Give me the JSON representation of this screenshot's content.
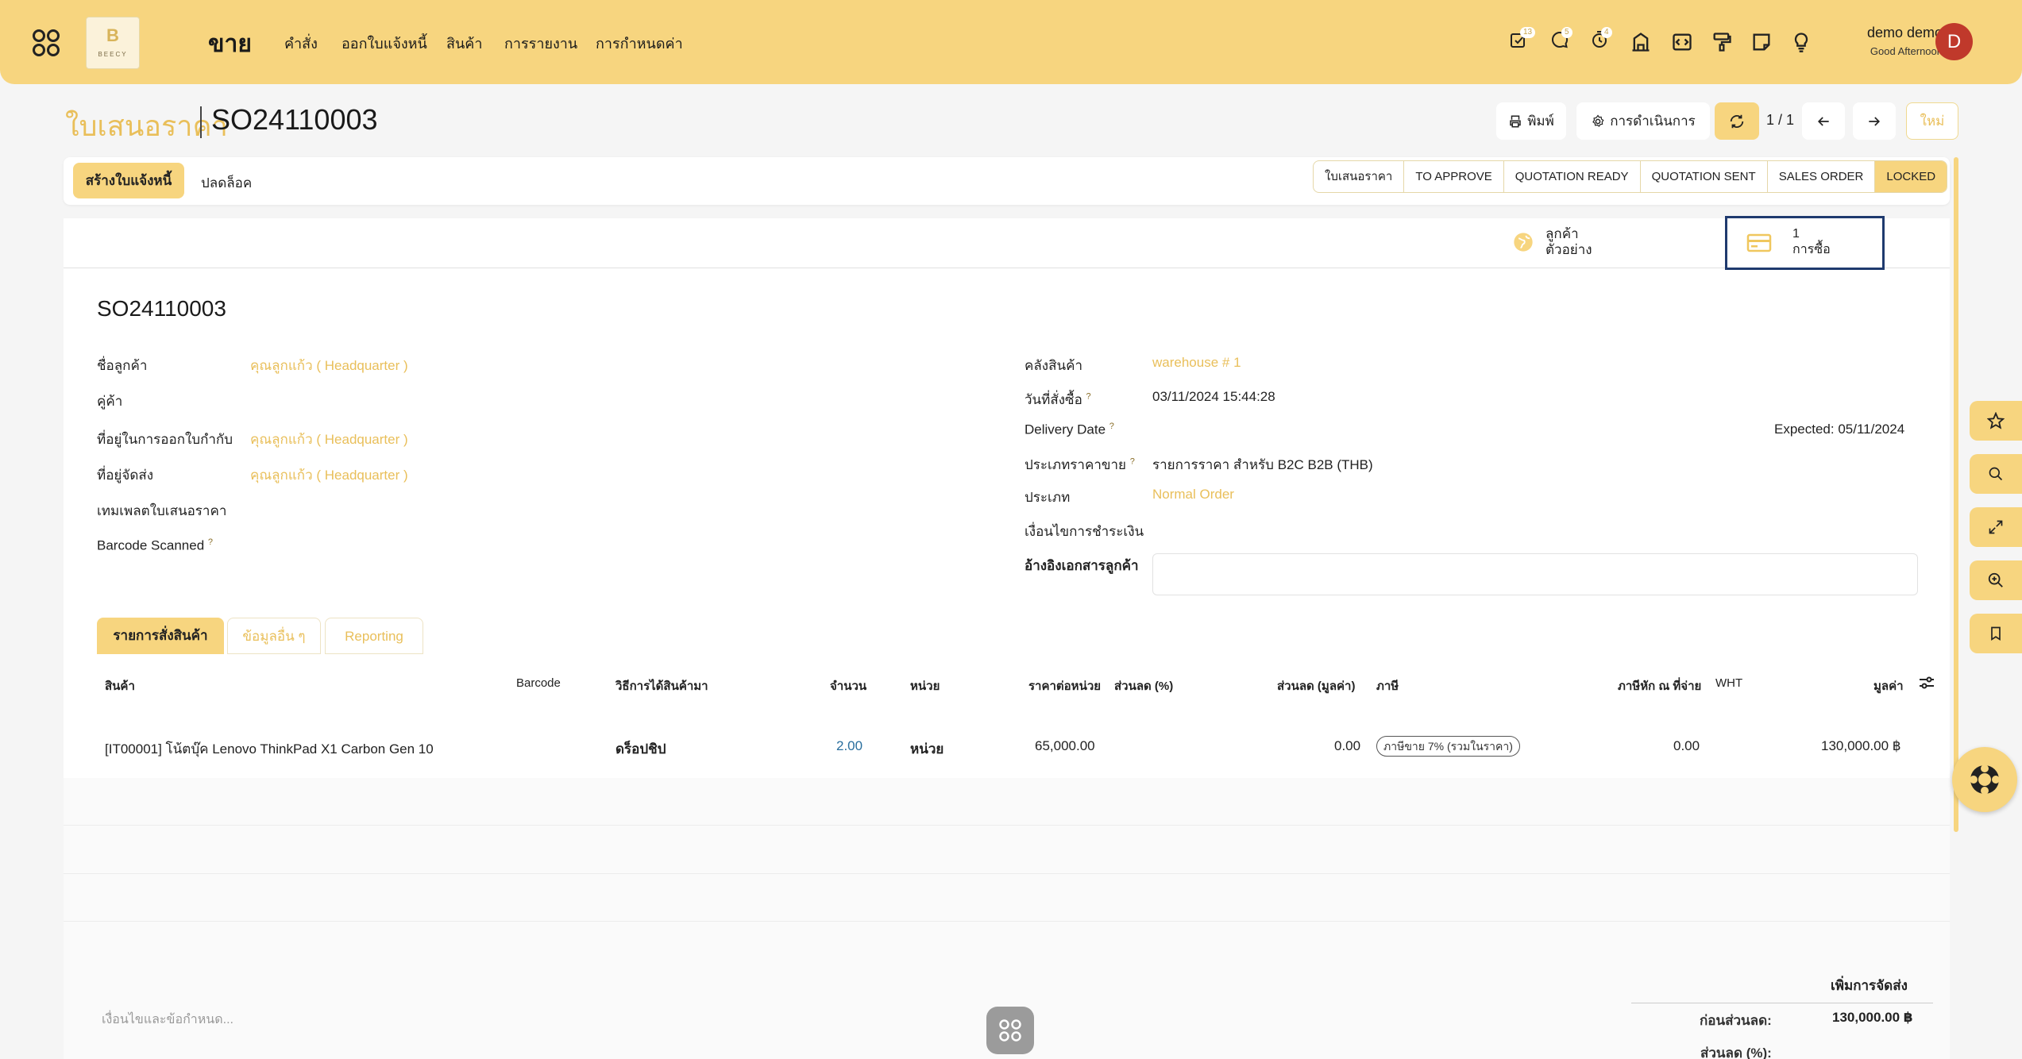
{
  "header": {
    "logo_letter": "B",
    "logo_text": "BEECY",
    "app_title": "ขาย",
    "menu": [
      "คำสั่ง",
      "ออกใบแจ้งหนี้",
      "สินค้า",
      "การรายงาน",
      "การกำหนดค่า"
    ],
    "badges": {
      "activity": "13",
      "messages": "5",
      "timer": "4"
    },
    "user_name": "demo demo",
    "greeting": "Good Afternoon",
    "avatar_letter": "D"
  },
  "breadcrumb": {
    "parent": "ใบเสนอราคา",
    "current": "SO24110003"
  },
  "toolbar": {
    "print": "พิมพ์",
    "actions": "การดำเนินการ",
    "pager": "1 / 1",
    "new": "ใหม่"
  },
  "statusbar": {
    "create_invoice": "สร้างใบแจ้งหนี้",
    "unlock": "ปลดล็อค",
    "stages": [
      "ใบเสนอราคา",
      "TO APPROVE",
      "QUOTATION READY",
      "QUOTATION SENT",
      "SALES ORDER",
      "LOCKED"
    ],
    "active_stage": "LOCKED"
  },
  "smart_buttons": {
    "customer_line1": "ลูกค้า",
    "customer_line2": "ตัวอย่าง",
    "purchase_count": "1",
    "purchase_label": "การซื้อ"
  },
  "form": {
    "title": "SO24110003",
    "left": {
      "customer_label": "ชื่อลูกค้า",
      "customer_value": "คุณลูกแก้ว ( Headquarter )",
      "partner_label": "คู่ค้า",
      "invoice_addr_label": "ที่อยู่ในการออกใบกำกับ",
      "invoice_addr_value": "คุณลูกแก้ว ( Headquarter )",
      "shipping_addr_label": "ที่อยู่จัดส่ง",
      "shipping_addr_value": "คุณลูกแก้ว ( Headquarter )",
      "template_label": "เทมเพลตใบเสนอราคา",
      "barcode_label": "Barcode Scanned"
    },
    "right": {
      "warehouse_label": "คลังสินค้า",
      "warehouse_value": "warehouse # 1",
      "order_date_label": "วันที่สั่งซื้อ",
      "order_date_value": "03/11/2024 15:44:28",
      "delivery_label": "Delivery Date",
      "delivery_value": "Expected: 05/11/2024",
      "pricelist_label": "ประเภทราคาขาย",
      "pricelist_value": "รายการราคา สำหรับ B2C B2B (THB)",
      "type_label": "ประเภท",
      "type_value": "Normal Order",
      "payment_terms_label": "เงื่อนไขการชำระเงิน",
      "customer_ref_label": "อ้างอิงเอกสารลูกค้า"
    },
    "help_mark": "?"
  },
  "tabs": [
    "รายการสั่งสินค้า",
    "ข้อมูลอื่น ๆ",
    "Reporting"
  ],
  "table": {
    "headers": [
      "สินค้า",
      "Barcode",
      "วิธีการได้สินค้ามา",
      "จำนวน",
      "หน่วย",
      "ราคาต่อหน่วย",
      "ส่วนลด (%)",
      "ส่วนลด (มูลค่า)",
      "ภาษี",
      "ภาษีหัก ณ ที่จ่าย",
      "WHT",
      "มูลค่า"
    ],
    "rows": [
      {
        "product": "[IT00001] โน้ตบุ๊ค Lenovo ThinkPad X1 Carbon Gen 10",
        "route": "ดร็อปชิป",
        "qty": "2.00",
        "uom": "หน่วย",
        "price": "65,000.00",
        "discount_value": "0.00",
        "tax": "ภาษีขาย 7% (รวมในราคา)",
        "wht": "0.00",
        "subtotal": "130,000.00 ฿"
      }
    ]
  },
  "footer": {
    "terms_placeholder": "เงื่อนไขและข้อกำหนด...",
    "add_shipping": "เพิ่มการจัดส่ง",
    "before_discount_label": "ก่อนส่วนลด:",
    "before_discount_value": "130,000.00 ฿",
    "discount_pct_label": "ส่วนลด (%):"
  },
  "colors": {
    "accent": "#f7d57f",
    "link": "#e9bf5a",
    "highlight_border": "#1f3a6e"
  }
}
